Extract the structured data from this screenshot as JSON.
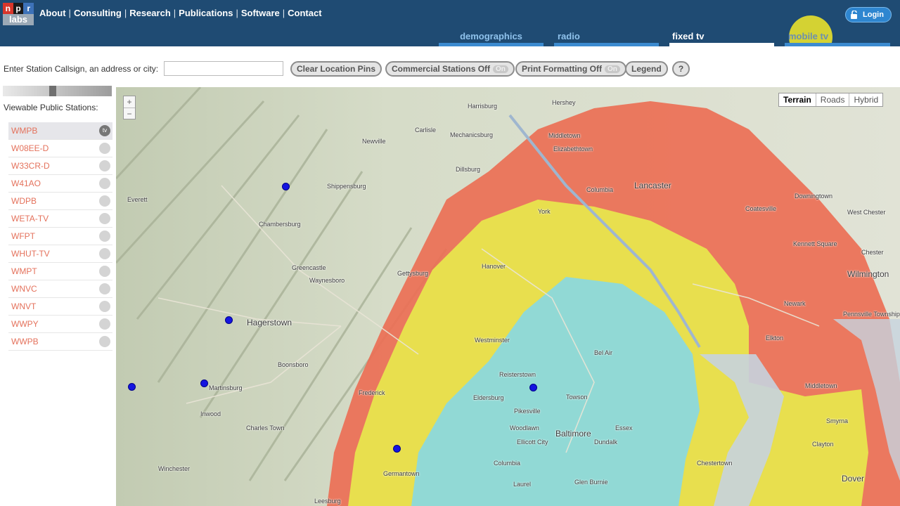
{
  "logo": {
    "letters": [
      "n",
      "p",
      "r"
    ],
    "sub": "labs"
  },
  "nav": {
    "items": [
      "About",
      "Consulting",
      "Research",
      "Publications",
      "Software",
      "Contact"
    ]
  },
  "login": {
    "label": "Login"
  },
  "tabs": [
    {
      "label": "demographics",
      "active": false
    },
    {
      "label": "radio",
      "active": false
    },
    {
      "label": "fixed tv",
      "active": true
    },
    {
      "label": "mobile tv",
      "active": false
    }
  ],
  "search": {
    "label": "Enter Station Callsign, an address or city:",
    "value": "",
    "placeholder": ""
  },
  "buttons": {
    "clear_pins": "Clear Location Pins",
    "commercial": "Commercial Stations Off",
    "commercial_toggle": "On",
    "print": "Print Formatting Off",
    "print_toggle": "On",
    "legend": "Legend",
    "help": "?"
  },
  "sidebar": {
    "title": "Viewable Public Stations:",
    "stations": [
      "WMPB",
      "W08EE-D",
      "W33CR-D",
      "W41AO",
      "WDPB",
      "WETA-TV",
      "WFPT",
      "WHUT-TV",
      "WMPT",
      "WNVC",
      "WNVT",
      "WWPY",
      "WWPB"
    ],
    "selected": "WMPB",
    "icon": "tv"
  },
  "map": {
    "types": [
      "Terrain",
      "Roads",
      "Hybrid"
    ],
    "selected_type": "Terrain",
    "zoom_in": "+",
    "zoom_out": "−",
    "labels": [
      "Harrisburg",
      "Hershey",
      "Carlisle",
      "Mechanicsburg",
      "Lancaster",
      "Chambersburg",
      "Hagerstown",
      "Martinsburg",
      "Frederick",
      "Westminster",
      "Reisterstown",
      "Baltimore",
      "Towson",
      "Columbia",
      "Ellicott City",
      "Woodlawn",
      "Glen Burnie",
      "Wilmington",
      "Newark",
      "York",
      "Gettysburg",
      "Hanover",
      "Winchester",
      "Charles Town",
      "Leesburg",
      "Germantown",
      "Dover",
      "Chestertown",
      "Elkton",
      "Bel Air",
      "Columbia",
      "Downingtown",
      "West Chester",
      "Coatesville",
      "Shippensburg",
      "Waynesboro",
      "Greencastle",
      "Everett",
      "Inwood",
      "Boonsboro",
      "Middletown",
      "Elizabethtown",
      "Dillsburg",
      "Newville",
      "Pikesville",
      "Essex",
      "Dundalk",
      "Laurel",
      "Eldersburg",
      "Smyrna",
      "Middletown",
      "Clayton",
      "Kennett Square",
      "Pennsville Township",
      "Chester"
    ],
    "pins": 6
  },
  "colors": {
    "header_bg": "#1f4b73",
    "tab_inactive": "#8fc2ec",
    "station_text": "#e4725c",
    "coverage_red": "#ec6f55",
    "coverage_yellow": "#e8e54d",
    "coverage_cyan": "#8cd8dc",
    "pin": "#1414e0"
  }
}
